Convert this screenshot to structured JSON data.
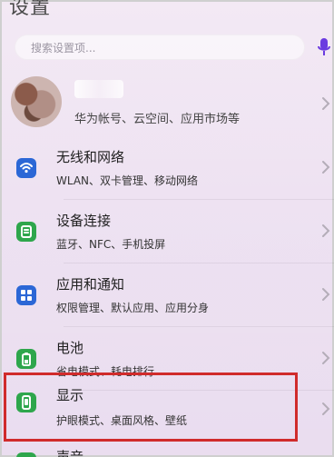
{
  "header": {
    "title": "设置"
  },
  "search": {
    "placeholder": "搜索设置项..."
  },
  "profile": {
    "subtitle": "华为帐号、云空间、应用市场等"
  },
  "items": [
    {
      "title": "无线和网络",
      "subtitle": "WLAN、双卡管理、移动网络",
      "icon": "wifi-icon",
      "color": "#2b67d6"
    },
    {
      "title": "设备连接",
      "subtitle": "蓝牙、NFC、手机投屏",
      "icon": "device-connection-icon",
      "color": "#2ea64c"
    },
    {
      "title": "应用和通知",
      "subtitle": "权限管理、默认应用、应用分身",
      "icon": "apps-grid-icon",
      "color": "#2b67d6"
    },
    {
      "title": "电池",
      "subtitle": "省电模式、耗电排行",
      "icon": "battery-icon",
      "color": "#2ea64c"
    },
    {
      "title": "显示",
      "subtitle": "护眼模式、桌面风格、壁纸",
      "icon": "display-phone-icon",
      "color": "#2ea64c"
    }
  ],
  "next_item": {
    "title": "声音"
  },
  "colors": {
    "highlight": "#d02b2b",
    "mic": "#6b3be0"
  }
}
